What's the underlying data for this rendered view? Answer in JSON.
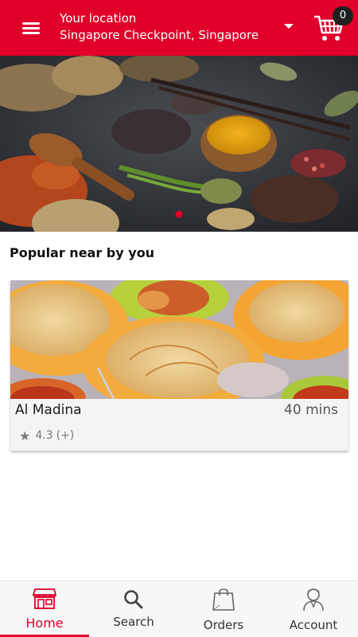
{
  "header": {
    "location_label": "Your location",
    "location_value": "Singapore Checkpoint, Singapore",
    "cart_count": "0",
    "brand_color": "#e0002a",
    "icons": [
      "menu-icon",
      "dropdown-caret-icon",
      "cart-icon"
    ]
  },
  "banner": {
    "image_alt": "spices banner",
    "active_indicator_color": "#e0002a"
  },
  "sections": {
    "popular_title": "Popular near by you"
  },
  "restaurants": [
    {
      "name": "Al Madina",
      "delivery_time": "40 mins",
      "rating": "4.3",
      "rating_count": "(+)"
    }
  ],
  "bottom_nav": {
    "items": [
      {
        "label": "Home",
        "icon": "store-icon",
        "active": true
      },
      {
        "label": "Search",
        "icon": "search-icon",
        "active": false
      },
      {
        "label": "Orders",
        "icon": "shopping-bag-icon",
        "active": false
      },
      {
        "label": "Account",
        "icon": "user-icon",
        "active": false
      }
    ]
  }
}
